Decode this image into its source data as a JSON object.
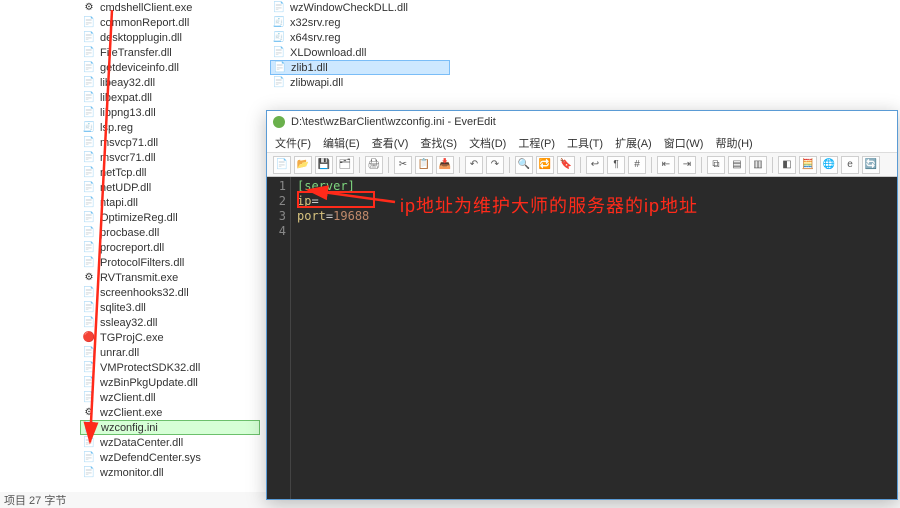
{
  "explorer": {
    "col1": [
      {
        "name": "cmdshellClient.exe",
        "icon": "⚙"
      },
      {
        "name": "commonReport.dll",
        "icon": "📄"
      },
      {
        "name": "desktopplugin.dll",
        "icon": "📄"
      },
      {
        "name": "FileTransfer.dll",
        "icon": "📄"
      },
      {
        "name": "getdeviceinfo.dll",
        "icon": "📄"
      },
      {
        "name": "libeay32.dll",
        "icon": "📄"
      },
      {
        "name": "libexpat.dll",
        "icon": "📄"
      },
      {
        "name": "libpng13.dll",
        "icon": "📄"
      },
      {
        "name": "lsp.reg",
        "icon": "🧾"
      },
      {
        "name": "msvcp71.dll",
        "icon": "📄"
      },
      {
        "name": "msvcr71.dll",
        "icon": "📄"
      },
      {
        "name": "netTcp.dll",
        "icon": "📄"
      },
      {
        "name": "netUDP.dll",
        "icon": "📄"
      },
      {
        "name": "ntapi.dll",
        "icon": "📄"
      },
      {
        "name": "OptimizeReg.dll",
        "icon": "📄"
      },
      {
        "name": "procbase.dll",
        "icon": "📄"
      },
      {
        "name": "procreport.dll",
        "icon": "📄"
      },
      {
        "name": "ProtocolFilters.dll",
        "icon": "📄"
      },
      {
        "name": "RVTransmit.exe",
        "icon": "⚙"
      },
      {
        "name": "screenhooks32.dll",
        "icon": "📄"
      },
      {
        "name": "sqlite3.dll",
        "icon": "📄"
      },
      {
        "name": "ssleay32.dll",
        "icon": "📄"
      },
      {
        "name": "TGProjC.exe",
        "icon": "🔴"
      },
      {
        "name": "unrar.dll",
        "icon": "📄"
      },
      {
        "name": "VMProtectSDK32.dll",
        "icon": "📄"
      },
      {
        "name": "wzBinPkgUpdate.dll",
        "icon": "📄"
      },
      {
        "name": "wzClient.dll",
        "icon": "📄"
      },
      {
        "name": "wzClient.exe",
        "icon": "⚙"
      },
      {
        "name": "wzconfig.ini",
        "icon": "📄",
        "highlight": true
      },
      {
        "name": "wzDataCenter.dll",
        "icon": "📄"
      },
      {
        "name": "wzDefendCenter.sys",
        "icon": "📄"
      },
      {
        "name": "wzmonitor.dll",
        "icon": "📄"
      }
    ],
    "col2": [
      {
        "name": "wzWindowCheckDLL.dll",
        "icon": "📄"
      },
      {
        "name": "x32srv.reg",
        "icon": "🧾"
      },
      {
        "name": "x64srv.reg",
        "icon": "🧾"
      },
      {
        "name": "XLDownload.dll",
        "icon": "📄"
      },
      {
        "name": "zlib1.dll",
        "icon": "📄",
        "selected": true
      },
      {
        "name": "zlibwapi.dll",
        "icon": "📄"
      }
    ]
  },
  "statusbar": "项目  27 字节",
  "editor": {
    "title": "D:\\test\\wzBarClient\\wzconfig.ini - EverEdit",
    "menu": [
      "文件(F)",
      "编辑(E)",
      "查看(V)",
      "查找(S)",
      "文档(D)",
      "工程(P)",
      "工具(T)",
      "扩展(A)",
      "窗口(W)",
      "帮助(H)"
    ],
    "gutter": [
      "1",
      "2",
      "3",
      "4"
    ],
    "code": {
      "l1_section": "[server]",
      "l2_key": "ip",
      "l2_eq": "=",
      "l3_key": "port",
      "l3_eq": "=",
      "l3_val": "19688"
    }
  },
  "annotation": "ip地址为维护大师的服务器的ip地址"
}
